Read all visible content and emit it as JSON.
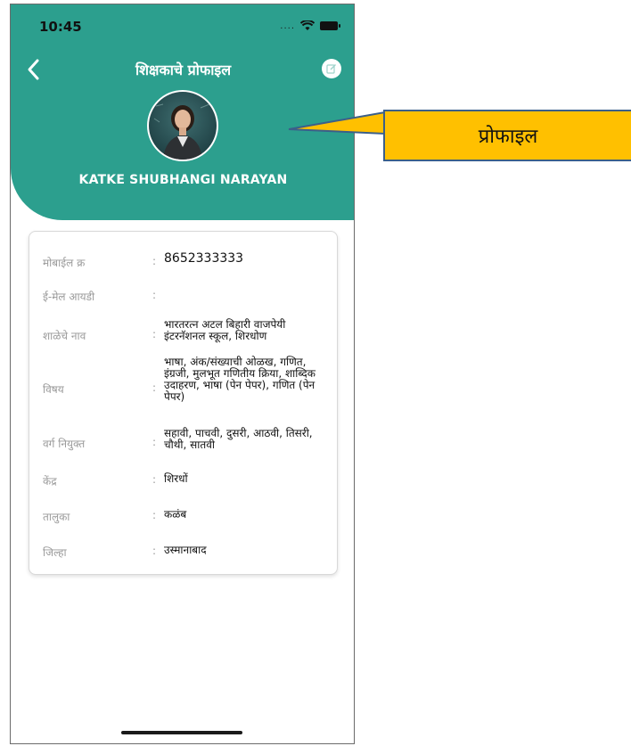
{
  "status_bar": {
    "time": "10:45",
    "signal": "...."
  },
  "header": {
    "title": "शिक्षकाचे प्रोफाइल",
    "teacher_name": "KATKE SHUBHANGI NARAYAN"
  },
  "profile_fields": [
    {
      "label": "मोबाईल क्र",
      "value": "8652333333"
    },
    {
      "label": "ई-मेल आयडी",
      "value": ""
    },
    {
      "label": "शाळेचे नाव",
      "value": "भारतरत्न अटल बिहारी वाजपेयी इंटरनॅशनल स्कूल, शिरधोण"
    },
    {
      "label": "विषय",
      "value": "भाषा, अंक/संख्याची ओळख, गणित, इंग्रजी, मुलभूत गणितीय क्रिया, शाब्दिक उदाहरण, भाषा (पेन पेपर), गणित (पेन पेपर)"
    },
    {
      "label": "वर्ग नियुक्त",
      "value": "सहावी, पाचवी, दुसरी, आठवी, तिसरी, चौथी, सातवी"
    },
    {
      "label": "केंद्र",
      "value": "शिरधों"
    },
    {
      "label": "तालुका",
      "value": "कळंब"
    },
    {
      "label": "जिल्हा",
      "value": "उस्मानाबाद"
    }
  ],
  "callout": {
    "text": "प्रोफाइल"
  },
  "icons": {
    "back": "chevron-left-icon",
    "edit": "edit-icon",
    "wifi": "wifi-icon",
    "battery": "battery-icon"
  },
  "colors": {
    "header_bg": "#2c9f8e",
    "callout_bg": "#ffc000",
    "callout_border": "#3b5f8a"
  }
}
